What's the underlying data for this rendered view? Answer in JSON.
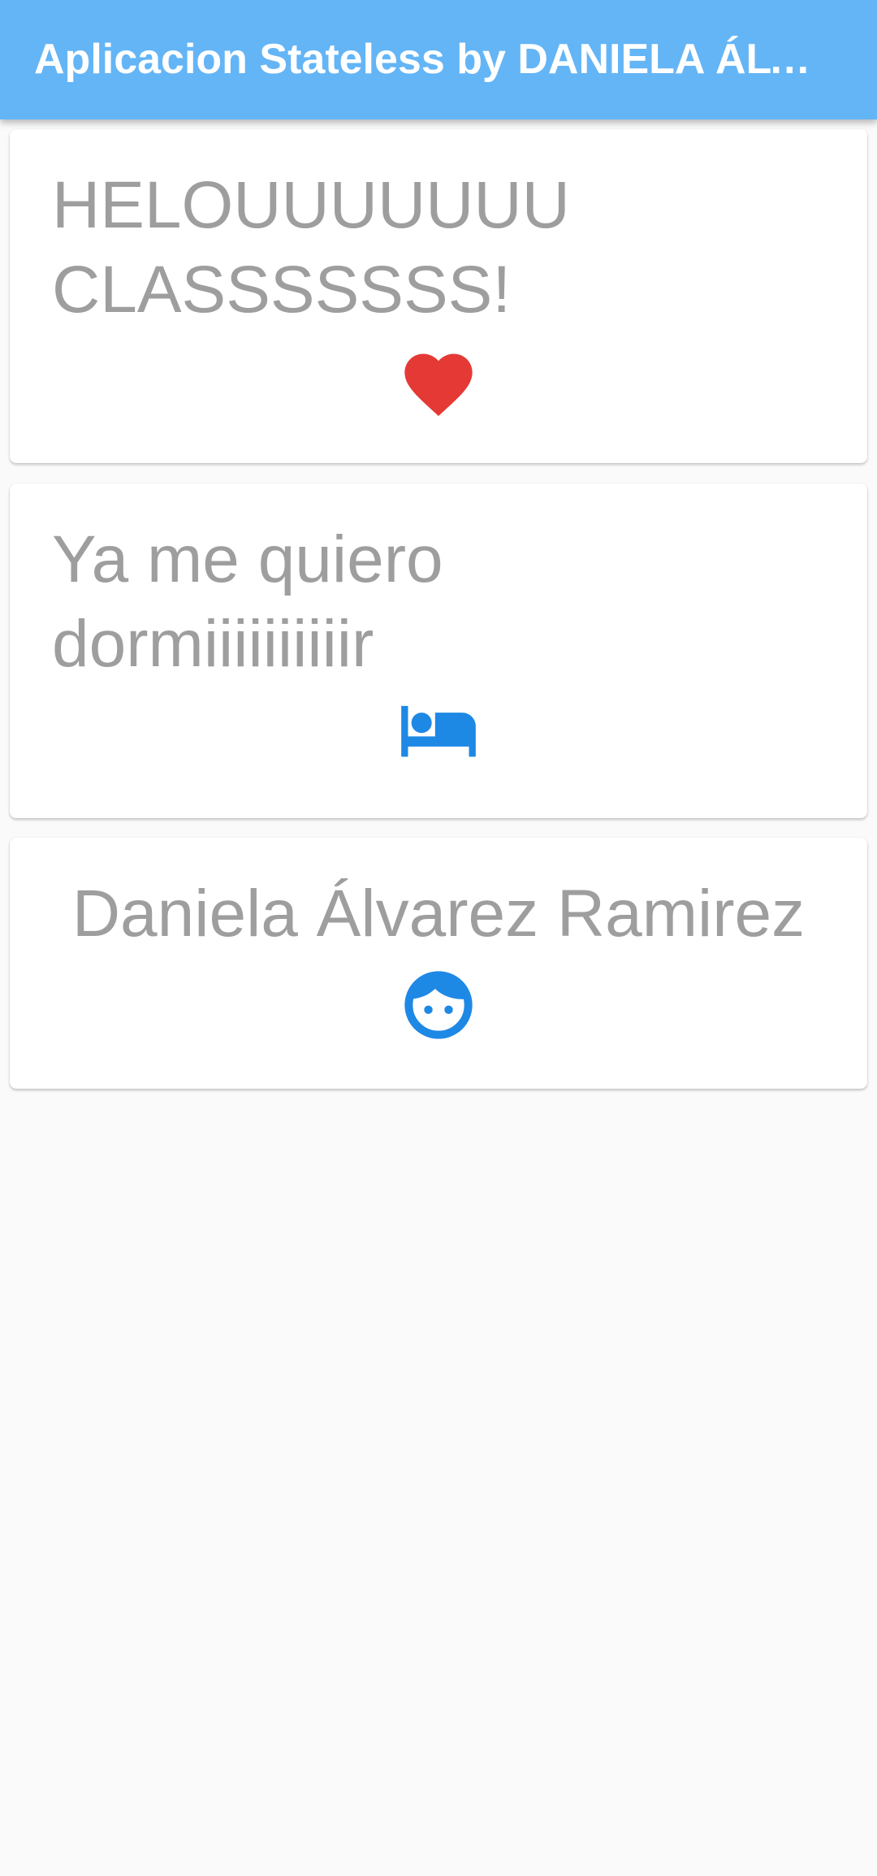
{
  "app_bar": {
    "title": "Aplicacion Stateless by DANIELA ÁLVAREZ RAMIREZ",
    "color": "#64b5f6"
  },
  "cards": [
    {
      "text": "HELOUUUUUUU CLASSSSSSS!",
      "icon": "heart-icon",
      "icon_color": "#e53935"
    },
    {
      "text": "Ya me quiero dormiiiiiiiiiir",
      "icon": "bed-icon",
      "icon_color": "#1e88e5"
    },
    {
      "text": "Daniela Álvarez Ramirez",
      "icon": "face-icon",
      "icon_color": "#1e88e5"
    }
  ],
  "text_color": "#9e9e9e",
  "background": "#fafafa"
}
